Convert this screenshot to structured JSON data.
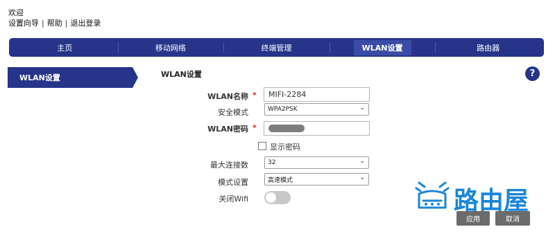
{
  "header": {
    "welcome": "欢迎",
    "links": [
      "设置向导",
      "帮助",
      "退出登录"
    ],
    "separator": "|"
  },
  "nav": {
    "items": [
      "主页",
      "移动网络",
      "终端管理",
      "WLAN设置",
      "路由器"
    ],
    "active_index": 3
  },
  "sidebar": {
    "items": [
      {
        "label": "WLAN设置"
      }
    ]
  },
  "section": {
    "title": "WLAN设置"
  },
  "help": {
    "glyph": "?"
  },
  "form": {
    "ssid_label": "WLAN名称",
    "ssid_value": "MIFI-2284",
    "security_label": "安全模式",
    "security_value": "WPA2PSK",
    "password_label": "WLAN密码",
    "show_password_label": "显示密码",
    "show_password_checked": false,
    "max_conn_label": "最大连接数",
    "max_conn_value": "32",
    "mode_label": "模式设置",
    "mode_value": "高速模式",
    "wifi_off_label": "关闭Wifi",
    "wifi_off_enabled": false,
    "required_mark": "*"
  },
  "buttons": {
    "apply": "应用",
    "cancel": "取消"
  },
  "watermark": {
    "text": "路由屋",
    "color": "#1a86d9"
  },
  "colors": {
    "primary": "#26358a",
    "required": "#d9222a",
    "button": "#6b6b6b"
  }
}
